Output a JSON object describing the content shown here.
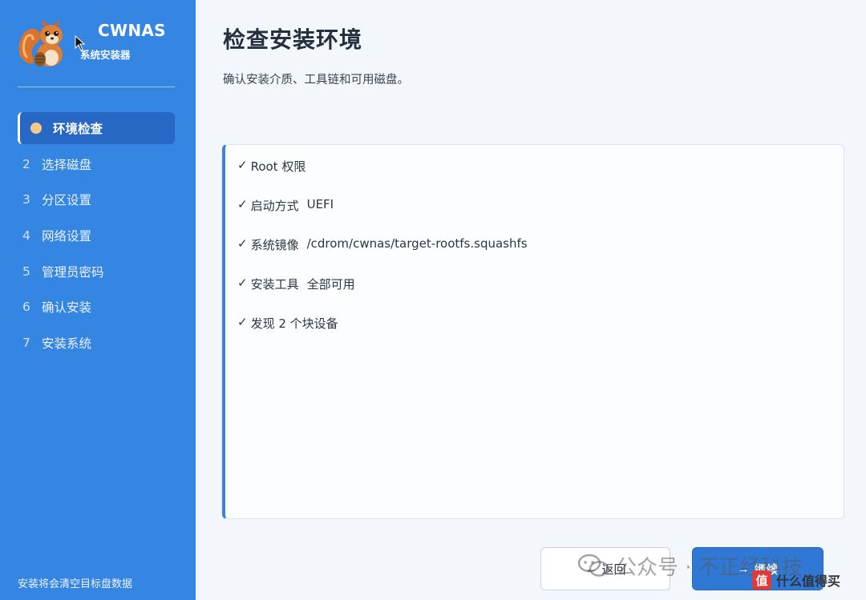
{
  "app": {
    "name": "CWNAS",
    "subtitle": "系统安装器"
  },
  "sidebar": {
    "steps": [
      {
        "num": "",
        "label": "环境检查",
        "active": true
      },
      {
        "num": "2",
        "label": "选择磁盘"
      },
      {
        "num": "3",
        "label": "分区设置"
      },
      {
        "num": "4",
        "label": "网络设置"
      },
      {
        "num": "5",
        "label": "管理员密码"
      },
      {
        "num": "6",
        "label": "确认安装"
      },
      {
        "num": "7",
        "label": "安装系统"
      }
    ],
    "footer": "安装将会清空目标盘数据"
  },
  "main": {
    "title": "检查安装环境",
    "subtitle": "确认安装介质、工具链和可用磁盘。",
    "checks": [
      {
        "mark": "✓",
        "label": "Root 权限",
        "value": ""
      },
      {
        "mark": "✓",
        "label": "启动方式",
        "value": "UEFI"
      },
      {
        "mark": "✓",
        "label": "系统镜像",
        "value": "/cdrom/cwnas/target-rootfs.squashfs"
      },
      {
        "mark": "✓",
        "label": "安装工具",
        "value": "全部可用"
      },
      {
        "mark": "✓",
        "label": "发现 2 个块设备",
        "value": ""
      }
    ],
    "buttons": {
      "back_arrow": "←",
      "back_label": "返回",
      "next_arrow": "→",
      "next_label": "继续"
    }
  },
  "watermark": {
    "text": "公众号 · 不正经科技",
    "badge": "值",
    "site": "什么值得买"
  },
  "colors": {
    "sidebar": "#3585e2",
    "active_step": "#2668c4",
    "active_dot": "#f6c98b",
    "primary_button": "#2f78d6"
  }
}
